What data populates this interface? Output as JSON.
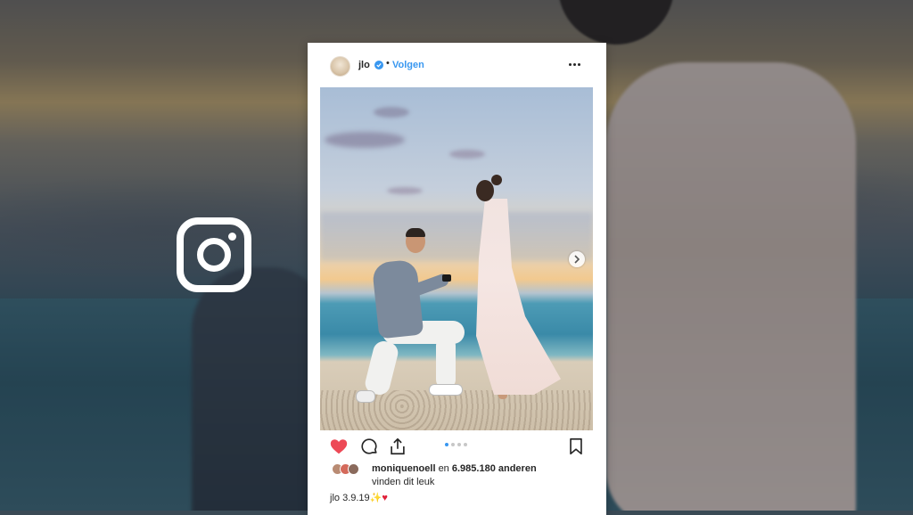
{
  "post": {
    "username": "jlo",
    "separator": "•",
    "follow_label": "Volgen",
    "more_label": "More options",
    "likes": {
      "first_liker": "moniquenoell",
      "connector": "en",
      "count_text": "6.985.180 anderen",
      "suffix": "vinden dit leuk"
    },
    "caption": {
      "username": "jlo",
      "date": "3.9.19",
      "sparkle": "✨",
      "heart": "♥"
    },
    "carousel": {
      "slides_total": 4,
      "current_slide": 1
    }
  },
  "icons": [
    "instagram-logo",
    "verified-icon",
    "more-icon",
    "next-arrow-icon",
    "heart-icon",
    "comment-icon",
    "share-icon",
    "bookmark-icon"
  ],
  "colors": {
    "link_blue": "#3897f0",
    "like_red": "#ed4956",
    "text": "#262626"
  }
}
